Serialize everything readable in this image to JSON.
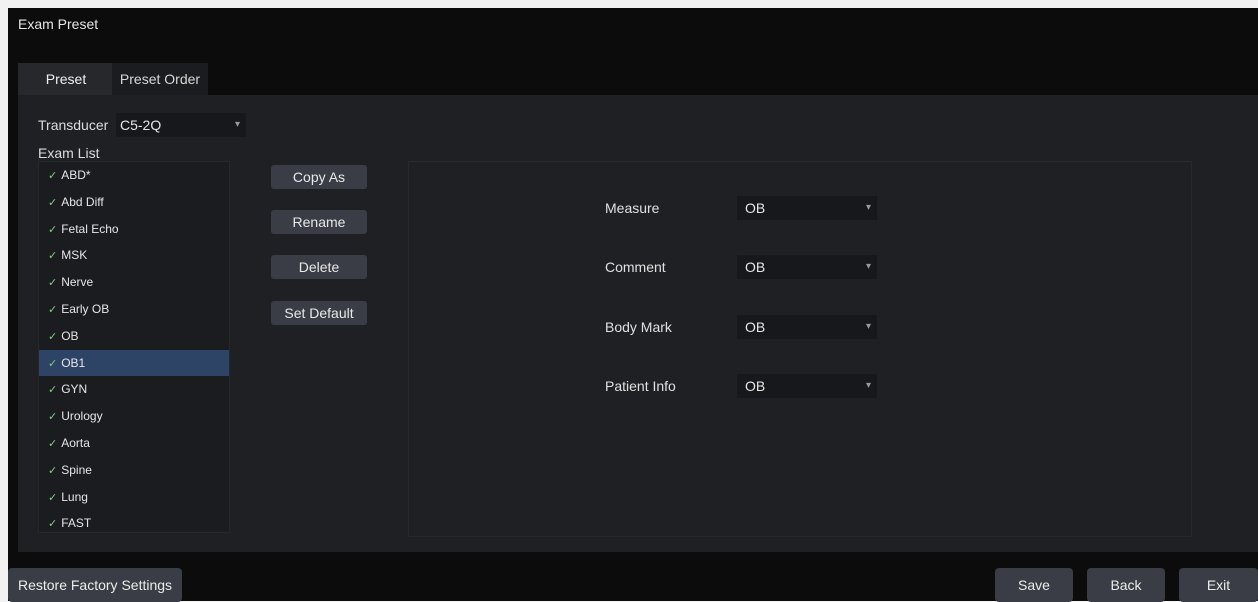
{
  "window": {
    "title": "Exam Preset"
  },
  "tabs": [
    {
      "label": "Preset",
      "active": true
    },
    {
      "label": "Preset Order",
      "active": false
    }
  ],
  "transducer": {
    "label": "Transducer",
    "value": "C5-2Q"
  },
  "exam_list": {
    "label": "Exam List",
    "check_icon": "✓",
    "selected": "OB1",
    "items": [
      "ABD*",
      "Abd Diff",
      "Fetal Echo",
      "MSK",
      "Nerve",
      "Early OB",
      "OB",
      "OB1",
      "GYN",
      "Urology",
      "Aorta",
      "Spine",
      "Lung",
      "FAST"
    ]
  },
  "actions": {
    "copy_as": "Copy As",
    "rename": "Rename",
    "delete": "Delete",
    "set_default": "Set Default"
  },
  "settings": {
    "measure": {
      "label": "Measure",
      "value": "OB"
    },
    "comment": {
      "label": "Comment",
      "value": "OB"
    },
    "body_mark": {
      "label": "Body Mark",
      "value": "OB"
    },
    "patient_info": {
      "label": "Patient Info",
      "value": "OB"
    }
  },
  "footer": {
    "restore": "Restore Factory Settings",
    "save": "Save",
    "back": "Back",
    "exit": "Exit"
  },
  "colors": {
    "background": "#0c0c0c",
    "panel": "#1e2024",
    "selected_row": "#2d4466",
    "button": "#3a3d45",
    "check": "#7ed07e"
  }
}
